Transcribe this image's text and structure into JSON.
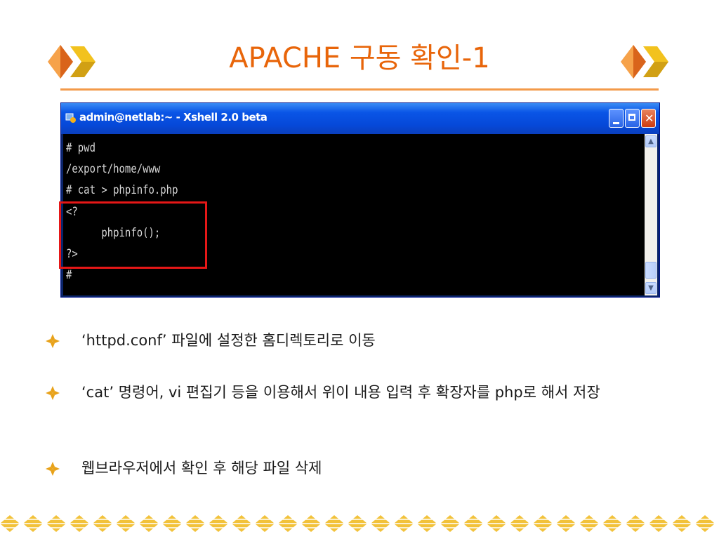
{
  "slide": {
    "title": "APACHE 구동 확인-1"
  },
  "window": {
    "title": "admin@netlab:~ - Xshell 2.0 beta",
    "scroll_up": "▲",
    "scroll_down": "▼"
  },
  "terminal": {
    "lines": [
      "# pwd",
      "/export/home/www",
      "# cat > phpinfo.php",
      "<?",
      "      phpinfo();",
      "?>",
      "#"
    ]
  },
  "bullets": [
    "‘httpd.conf’ 파일에 설정한 홈디렉토리로 이동",
    "‘cat’ 명령어, vi 편집기 등을 이용해서 위이 내용 입력 후 확장자를 php로 해서 저장",
    "웹브라우저에서 확인 후 해당 파일 삭제"
  ],
  "colors": {
    "title": "#e8650a",
    "highlight": "#e51717",
    "bullet": "#e8a21a"
  }
}
